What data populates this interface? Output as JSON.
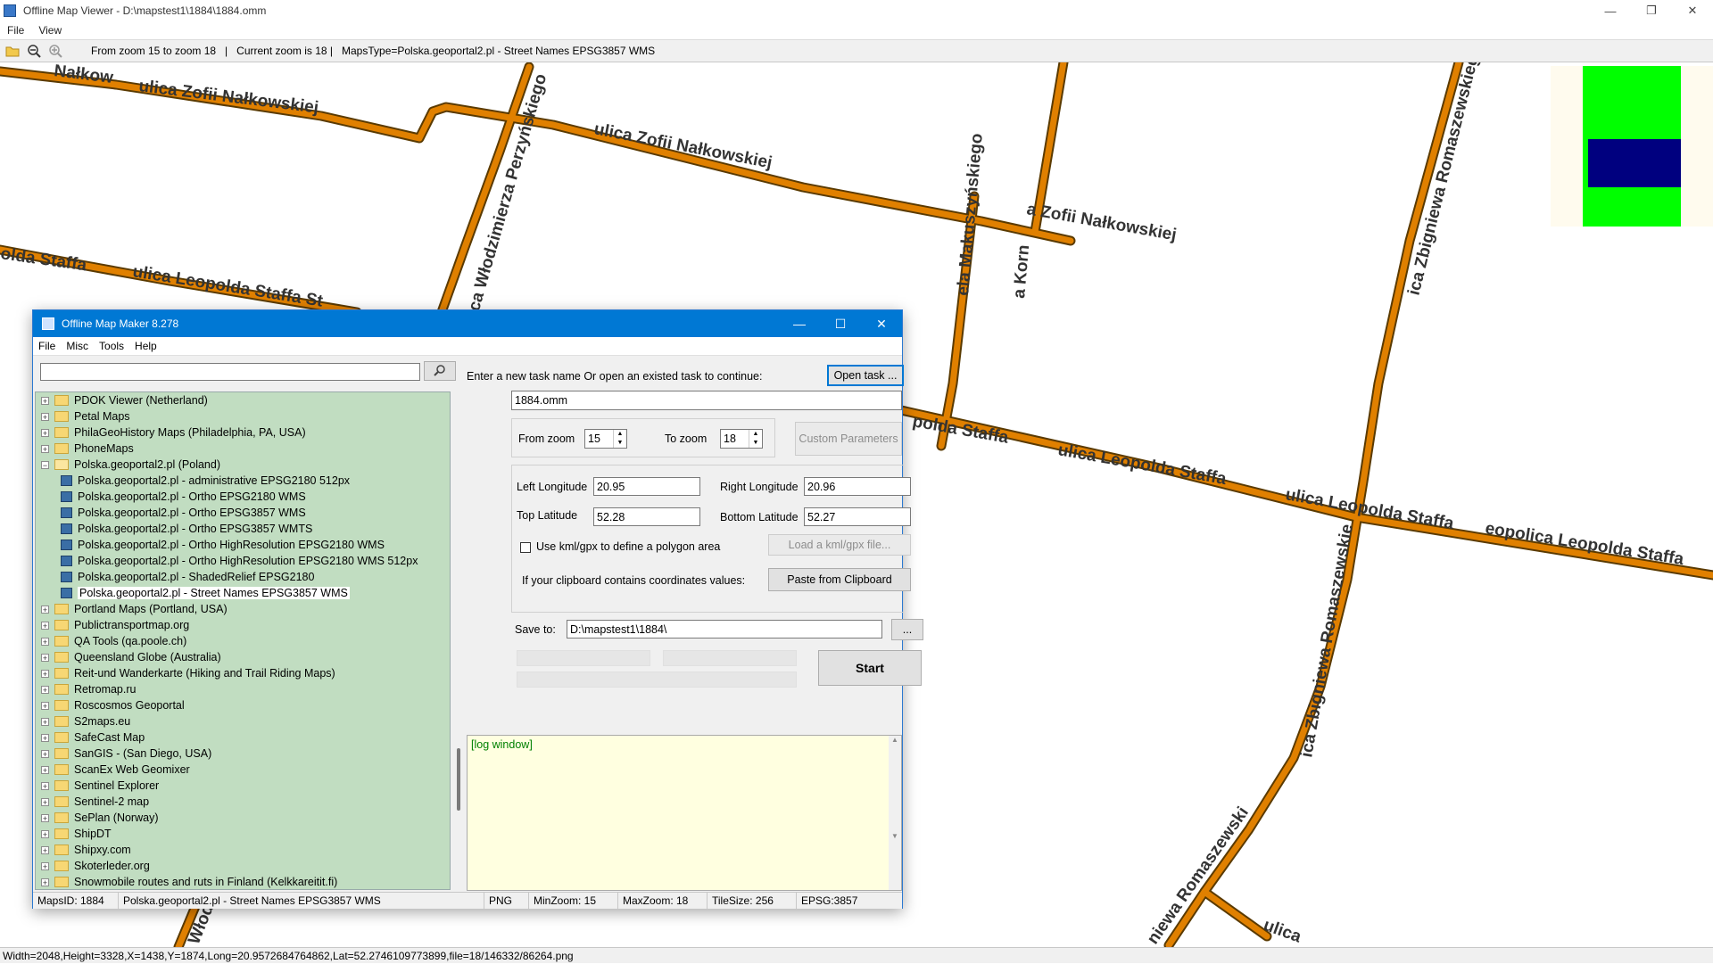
{
  "main_window": {
    "title": "Offline Map Viewer - D:\\mapstest1\\1884\\1884.omm",
    "menu": [
      "File",
      "View"
    ],
    "controls": {
      "minimize": "—",
      "maximize": "❐",
      "close": "✕"
    },
    "toolbar_info": "From zoom 15 to zoom 18   |   Current zoom is 18 |   MapsType=Polska.geoportal2.pl - Street Names EPSG3857 WMS"
  },
  "map": {
    "street_labels": {
      "nalkowskiej_top_left": "ulica Zofii Nałkowskiej",
      "nalkowskiej_top_far_left": "Nałkow",
      "nalkowskiej_mid": "ulica Zofii Nałkowskiej",
      "nalkowskiej_right": "a Zofii Nałkowskiej",
      "staffa_left_a": "olda Staffa",
      "staffa_left_b": "ulica Leopolda Staffa St",
      "staffa_mid_a": "polda Staffa",
      "staffa_mid_b": "ulica Leopolda Staffa",
      "staffa_mid_c": "ulica Leopolda Staffa",
      "staffa_right": "eopolica Leopolda Staffa",
      "przerzynskiego": "ica Włodzimierza Perzyńskiego",
      "makuszynskiego": "ela Makuszyńskiego",
      "kornela": "a Korn",
      "romaszewskiego_top": "ica Zbigniewa Romaszewskiego",
      "romaszewskiego_bottom": "ica Zbigniewa Romaszewskie",
      "romaszewski_bottom2": "niewa Romaszewski",
      "ulica_bottom": "ulica",
      "wlod_bottom": "Włod"
    },
    "road_color": "#e08000"
  },
  "viewer_status": "Width=2048,Height=3328,X=1438,Y=1874,Long=20.9572684764862,Lat=52.2746109773899,file=18/146332/86264.png",
  "dialog": {
    "title": "Offline Map Maker 8.278",
    "menu": [
      "File",
      "Misc",
      "Tools",
      "Help"
    ],
    "search_value": "",
    "tree": [
      {
        "label": "PDOK Viewer (Netherland)",
        "type": "folder",
        "indent": 0,
        "exp": "+"
      },
      {
        "label": "Petal Maps",
        "type": "folder",
        "indent": 0,
        "exp": "+"
      },
      {
        "label": "PhilaGeoHistory Maps (Philadelphia, PA, USA)",
        "type": "folder",
        "indent": 0,
        "exp": "+"
      },
      {
        "label": "PhoneMaps",
        "type": "folder",
        "indent": 0,
        "exp": "+"
      },
      {
        "label": "Polska.geoportal2.pl (Poland)",
        "type": "folder-open",
        "indent": 0,
        "exp": "−"
      },
      {
        "label": "Polska.geoportal2.pl - administrative EPSG2180 512px",
        "type": "map",
        "indent": 1
      },
      {
        "label": "Polska.geoportal2.pl - Ortho EPSG2180 WMS",
        "type": "map",
        "indent": 1
      },
      {
        "label": "Polska.geoportal2.pl - Ortho EPSG3857 WMS",
        "type": "map",
        "indent": 1
      },
      {
        "label": "Polska.geoportal2.pl - Ortho EPSG3857 WMTS",
        "type": "map",
        "indent": 1
      },
      {
        "label": "Polska.geoportal2.pl - Ortho HighResolution EPSG2180 WMS",
        "type": "map",
        "indent": 1
      },
      {
        "label": "Polska.geoportal2.pl - Ortho HighResolution EPSG2180 WMS 512px",
        "type": "map",
        "indent": 1
      },
      {
        "label": "Polska.geoportal2.pl - ShadedRelief EPSG2180",
        "type": "map",
        "indent": 1
      },
      {
        "label": "Polska.geoportal2.pl - Street Names EPSG3857 WMS",
        "type": "map",
        "indent": 1,
        "selected": true
      },
      {
        "label": "Portland Maps (Portland, USA)",
        "type": "folder",
        "indent": 0,
        "exp": "+"
      },
      {
        "label": "Publictransportmap.org",
        "type": "folder",
        "indent": 0,
        "exp": "+"
      },
      {
        "label": "QA Tools (qa.poole.ch)",
        "type": "folder",
        "indent": 0,
        "exp": "+"
      },
      {
        "label": "Queensland Globe (Australia)",
        "type": "folder",
        "indent": 0,
        "exp": "+"
      },
      {
        "label": "Reit-und Wanderkarte (Hiking and Trail Riding Maps)",
        "type": "folder",
        "indent": 0,
        "exp": "+"
      },
      {
        "label": "Retromap.ru",
        "type": "folder",
        "indent": 0,
        "exp": "+"
      },
      {
        "label": "Roscosmos Geoportal",
        "type": "folder",
        "indent": 0,
        "exp": "+"
      },
      {
        "label": "S2maps.eu",
        "type": "folder",
        "indent": 0,
        "exp": "+"
      },
      {
        "label": "SafeCast Map",
        "type": "folder",
        "indent": 0,
        "exp": "+"
      },
      {
        "label": "SanGIS - (San Diego, USA)",
        "type": "folder",
        "indent": 0,
        "exp": "+"
      },
      {
        "label": "ScanEx Web Geomixer",
        "type": "folder",
        "indent": 0,
        "exp": "+"
      },
      {
        "label": "Sentinel Explorer",
        "type": "folder",
        "indent": 0,
        "exp": "+"
      },
      {
        "label": "Sentinel-2 map",
        "type": "folder",
        "indent": 0,
        "exp": "+"
      },
      {
        "label": "SePlan (Norway)",
        "type": "folder",
        "indent": 0,
        "exp": "+"
      },
      {
        "label": "ShipDT",
        "type": "folder",
        "indent": 0,
        "exp": "+"
      },
      {
        "label": "Shipxy.com",
        "type": "folder",
        "indent": 0,
        "exp": "+"
      },
      {
        "label": "Skoterleder.org",
        "type": "folder",
        "indent": 0,
        "exp": "+"
      },
      {
        "label": "Snowmobile routes and ruts in Finland (Kelkkareitit.fi)",
        "type": "folder",
        "indent": 0,
        "exp": "+"
      }
    ],
    "task_prompt": "Enter a new task name Or open an existed task to continue:",
    "open_task_label": "Open task ...",
    "task_name": "1884.omm",
    "from_zoom_label": "From zoom",
    "from_zoom_value": "15",
    "to_zoom_label": "To zoom",
    "to_zoom_value": "18",
    "custom_params_label": "Custom Parameters",
    "left_lon_label": "Left Longitude",
    "left_lon_value": "20.95",
    "right_lon_label": "Right Longitude",
    "right_lon_value": "20.96",
    "top_lat_label": "Top Latitude",
    "top_lat_value": "52.28",
    "bottom_lat_label": "Bottom Latitude",
    "bottom_lat_value": "52.27",
    "kml_checkbox_label": "Use kml/gpx to define a polygon area",
    "load_kml_label": "Load a kml/gpx file...",
    "clipboard_label": "If your clipboard contains coordinates values:",
    "paste_label": "Paste from Clipboard",
    "save_to_label": "Save to:",
    "save_to_value": "D:\\mapstest1\\1884\\",
    "browse_label": "...",
    "start_label": "Start",
    "log_text": "[log window]",
    "status": {
      "maps_id": "MapsID: 1884",
      "name": "Polska.geoportal2.pl - Street Names EPSG3857 WMS",
      "format": "PNG",
      "min_zoom": "MinZoom: 15",
      "max_zoom": "MaxZoom: 18",
      "tile_size": "TileSize: 256",
      "epsg": "EPSG:3857"
    }
  }
}
